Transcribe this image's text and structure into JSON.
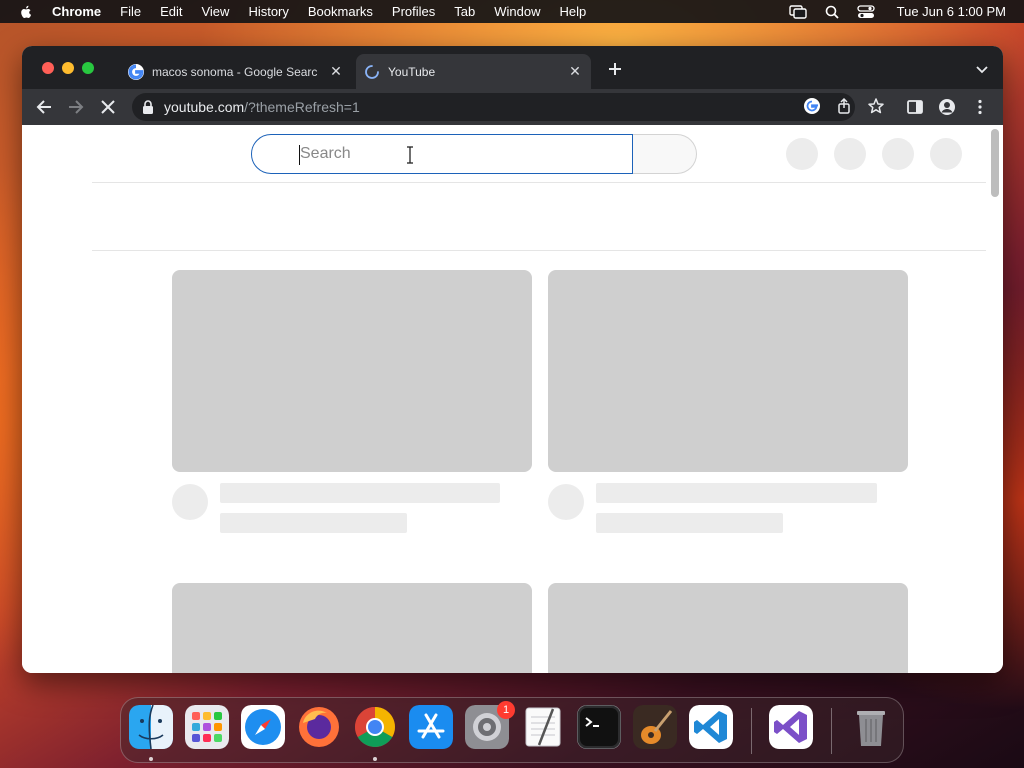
{
  "menubar": {
    "app": "Chrome",
    "items": [
      "File",
      "Edit",
      "View",
      "History",
      "Bookmarks",
      "Profiles",
      "Tab",
      "Window",
      "Help"
    ],
    "clock": "Tue Jun 6  1:00 PM"
  },
  "browser": {
    "tabs": [
      {
        "title": "macos sonoma - Google Searc",
        "favicon": "google-icon",
        "active": false
      },
      {
        "title": "YouTube",
        "favicon": "loading-spinner-icon",
        "active": true
      }
    ],
    "url_host": "youtube.com",
    "url_path": "/?themeRefresh=1"
  },
  "page": {
    "search_placeholder": "Search"
  },
  "dock": {
    "apps": [
      "Finder",
      "Launchpad",
      "Safari",
      "Firefox",
      "Chrome",
      "App Store",
      "System Settings",
      "TextEdit",
      "Terminal",
      "GarageBand",
      "Visual Studio Code",
      "Visual Studio",
      "Trash"
    ],
    "system_settings_badge": "1"
  },
  "colors": {
    "tabbar_bg": "#202124",
    "toolbar_bg": "#35363a",
    "search_focus": "#1c62b9",
    "placeholder_gray": "#cfcfcf"
  }
}
